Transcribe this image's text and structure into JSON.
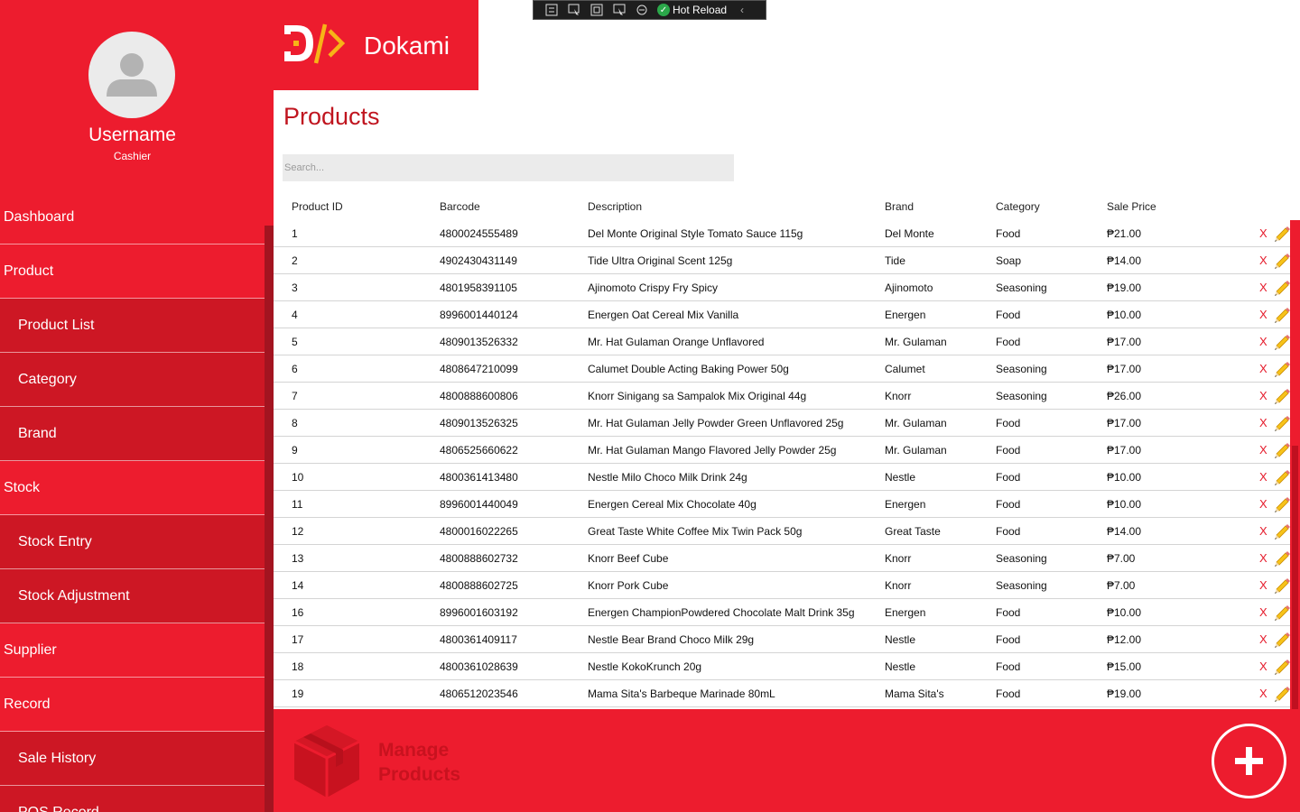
{
  "app": {
    "logo_text": "Dokami",
    "page_title": "Products"
  },
  "debug_toolbar": {
    "hot_reload_label": "Hot Reload"
  },
  "user": {
    "name": "Username",
    "role": "Cashier"
  },
  "sidebar": {
    "items": [
      {
        "label": "Dashboard",
        "sub": false
      },
      {
        "label": "Product",
        "sub": false
      },
      {
        "label": "Product List",
        "sub": true
      },
      {
        "label": "Category",
        "sub": true
      },
      {
        "label": "Brand",
        "sub": true
      },
      {
        "label": "Stock",
        "sub": false
      },
      {
        "label": "Stock Entry",
        "sub": true
      },
      {
        "label": "Stock Adjustment",
        "sub": true
      },
      {
        "label": "Supplier",
        "sub": false
      },
      {
        "label": "Record",
        "sub": false
      },
      {
        "label": "Sale History",
        "sub": true
      },
      {
        "label": "POS Record",
        "sub": true
      }
    ]
  },
  "search": {
    "placeholder": "Search..."
  },
  "table": {
    "headers": [
      "Product ID",
      "Barcode",
      "Description",
      "Brand",
      "Category",
      "Sale Price"
    ],
    "delete_label": "X",
    "rows": [
      [
        "1",
        "4800024555489",
        "Del Monte Original Style Tomato Sauce 115g",
        "Del Monte",
        "Food",
        "₱21.00"
      ],
      [
        "2",
        "4902430431149",
        "Tide Ultra Original Scent 125g",
        "Tide",
        "Soap",
        "₱14.00"
      ],
      [
        "3",
        "4801958391105",
        "Ajinomoto Crispy Fry Spicy",
        "Ajinomoto",
        "Seasoning",
        "₱19.00"
      ],
      [
        "4",
        "8996001440124",
        "Energen Oat Cereal Mix Vanilla",
        "Energen",
        "Food",
        "₱10.00"
      ],
      [
        "5",
        "4809013526332",
        "Mr. Hat Gulaman Orange Unflavored",
        "Mr. Gulaman",
        "Food",
        "₱17.00"
      ],
      [
        "6",
        "4808647210099",
        "Calumet Double Acting Baking Power 50g",
        "Calumet",
        "Seasoning",
        "₱17.00"
      ],
      [
        "7",
        "4800888600806",
        "Knorr Sinigang sa Sampalok Mix Original 44g",
        "Knorr",
        "Seasoning",
        "₱26.00"
      ],
      [
        "8",
        "4809013526325",
        "Mr. Hat Gulaman Jelly Powder Green Unflavored 25g",
        "Mr. Gulaman",
        "Food",
        "₱17.00"
      ],
      [
        "9",
        "4806525660622",
        "Mr. Hat Gulaman Mango Flavored Jelly Powder 25g",
        "Mr. Gulaman",
        "Food",
        "₱17.00"
      ],
      [
        "10",
        "4800361413480",
        "Nestle Milo Choco Milk Drink 24g",
        "Nestle",
        "Food",
        "₱10.00"
      ],
      [
        "11",
        "8996001440049",
        "Energen Cereal Mix Chocolate 40g",
        "Energen",
        "Food",
        "₱10.00"
      ],
      [
        "12",
        "4800016022265",
        "Great Taste White Coffee Mix Twin Pack 50g",
        "Great Taste",
        "Food",
        "₱14.00"
      ],
      [
        "13",
        "4800888602732",
        "Knorr Beef Cube",
        "Knorr",
        "Seasoning",
        "₱7.00"
      ],
      [
        "14",
        "4800888602725",
        "Knorr Pork Cube",
        "Knorr",
        "Seasoning",
        "₱7.00"
      ],
      [
        "16",
        "8996001603192",
        "Energen ChampionPowdered Chocolate Malt Drink 35g",
        "Energen",
        "Food",
        "₱10.00"
      ],
      [
        "17",
        "4800361409117",
        "Nestle Bear Brand Choco Milk 29g",
        "Nestle",
        "Food",
        "₱12.00"
      ],
      [
        "18",
        "4800361028639",
        "Nestle KokoKrunch 20g",
        "Nestle",
        "Food",
        "₱15.00"
      ],
      [
        "19",
        "4806512023546",
        "Mama Sita's Barbeque Marinade 80mL",
        "Mama Sita's",
        "Food",
        "₱19.00"
      ]
    ]
  },
  "footer": {
    "manage_line1": "Manage",
    "manage_line2": "Products"
  },
  "colors": {
    "brand_red": "#ed1c2e",
    "sub_nav_red": "#cd1724",
    "title_red": "#c0151f"
  }
}
